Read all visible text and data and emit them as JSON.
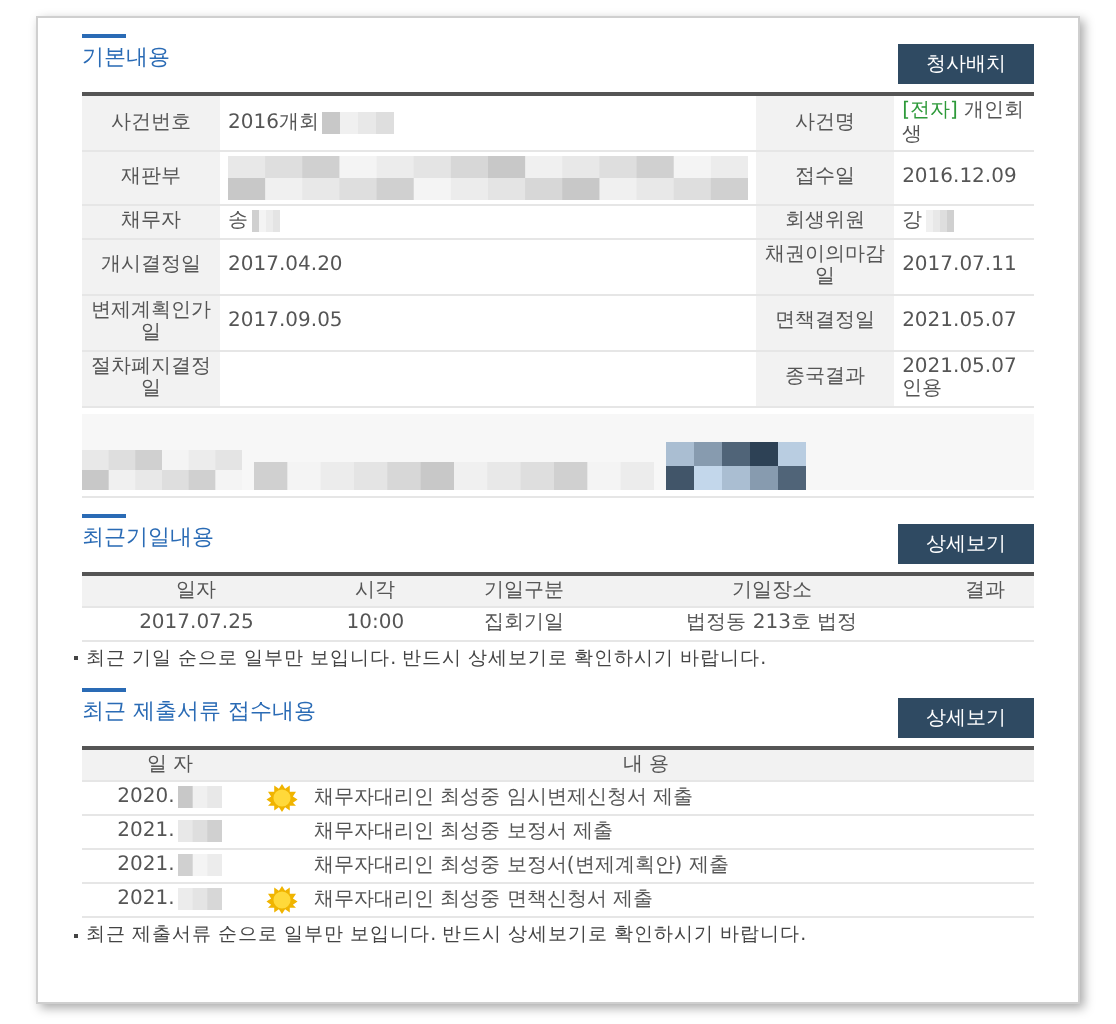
{
  "basic_info": {
    "title": "기본내용",
    "button": "청사배치",
    "rows": [
      {
        "label": "사건번호",
        "value": {
          "text": "2016개회",
          "redacted": true
        },
        "label_2": "사건명",
        "value_2": {
          "tag": "[전자]",
          "text": "개인회생"
        }
      },
      {
        "label": "재판부",
        "value": {
          "redacted": true,
          "kind": "block"
        },
        "label_2": "접수일",
        "value_2": {
          "text": "2016.12.09"
        }
      },
      {
        "label": "채무자",
        "value": {
          "text": "송",
          "redacted": true
        },
        "label_2": "회생위원",
        "value_2": {
          "text": "강",
          "redacted": true
        }
      },
      {
        "label": "개시결정일",
        "value": {
          "text": "2017.04.20"
        },
        "label_2": "채권이의마감일",
        "value_2": {
          "text": "2017.07.11"
        }
      },
      {
        "label": "변제계획인가일",
        "value": {
          "text": "2017.09.05"
        },
        "label_2": "면책결정일",
        "value_2": {
          "text": "2021.05.07"
        }
      },
      {
        "label": "절차폐지결정일",
        "value": {},
        "label_2": "종국결과",
        "value_2": {
          "text": "2021.05.07 인용"
        }
      }
    ]
  },
  "hearings": {
    "title": "최근기일내용",
    "button": "상세보기",
    "columns": [
      "일자",
      "시각",
      "기일구분",
      "기일장소",
      "결과"
    ],
    "rows": [
      [
        "2017.07.25",
        "10:00",
        "집회기일",
        "법정동 213호 법정"
      ]
    ],
    "note": "최근 기일 순으로 일부만 보입니다. 반드시 상세보기로 확인하시기 바랍니다."
  },
  "documents": {
    "title": "최근 제출서류 접수내용",
    "button": "상세보기",
    "columns": [
      "일 자",
      "내 용"
    ],
    "rows": [
      {
        "date": "2020.",
        "redacted": true,
        "icon": true,
        "content": "채무자대리인 최성중 임시변제신청서 제출"
      },
      {
        "date": "2021.",
        "redacted": true,
        "icon": false,
        "content": "채무자대리인 최성중 보정서 제출"
      },
      {
        "date": "2021.",
        "redacted": true,
        "icon": false,
        "content": "채무자대리인 최성중 보정서(변제계획안) 제출"
      },
      {
        "date": "2021.",
        "redacted": true,
        "icon": true,
        "content": "채무자대리인 최성중 면책신청서 제출"
      }
    ],
    "note": "최근 제출서류 순으로 일부만 보입니다. 반드시 상세보기로 확인하시기 바랍니다."
  }
}
